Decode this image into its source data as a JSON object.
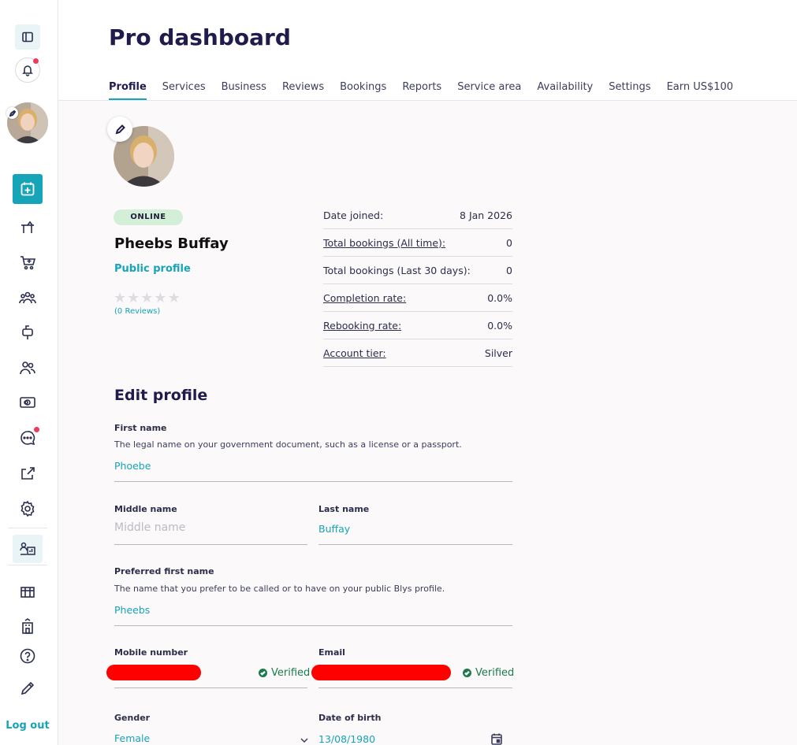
{
  "header": {
    "title": "Pro dashboard"
  },
  "tabs": [
    {
      "label": "Profile",
      "active": true
    },
    {
      "label": "Services"
    },
    {
      "label": "Business"
    },
    {
      "label": "Reviews"
    },
    {
      "label": "Bookings"
    },
    {
      "label": "Reports"
    },
    {
      "label": "Service area"
    },
    {
      "label": "Availability"
    },
    {
      "label": "Settings"
    },
    {
      "label": "Earn US$100"
    }
  ],
  "sidebar": {
    "logout_label": "Log out",
    "icons": [
      "sidebar-toggle-icon",
      "bell-icon",
      "avatar",
      "calendar-plus-icon",
      "massage-table-icon",
      "cart-icon",
      "team-icon",
      "mailbox-icon",
      "users-icon",
      "cash-icon",
      "chat-icon",
      "share-icon",
      "gear-icon",
      "pro-dashboard-icon",
      "gift-icon",
      "building-icon",
      "help-icon",
      "pencil-icon"
    ]
  },
  "profile": {
    "status": "ONLINE",
    "name": "Pheebs Buffay",
    "public_profile_label": "Public profile",
    "rating_stars": 0,
    "reviews_label": "(0 Reviews)"
  },
  "stats": [
    {
      "label": "Date joined:",
      "value": "8 Jan 2026",
      "underline": false
    },
    {
      "label": "Total bookings (All time):",
      "value": "0",
      "underline": true
    },
    {
      "label": "Total bookings (Last 30 days):",
      "value": "0",
      "underline": false
    },
    {
      "label": "Completion rate:",
      "value": "0.0%",
      "underline": true
    },
    {
      "label": "Rebooking rate:",
      "value": "0.0%",
      "underline": true
    },
    {
      "label": "Account tier:",
      "value": "Silver",
      "underline": true
    }
  ],
  "edit": {
    "title": "Edit profile",
    "first_name": {
      "label": "First name",
      "help": "The legal name on your government document, such as a license or a passport.",
      "value": "Phoebe"
    },
    "middle_name": {
      "label": "Middle name",
      "placeholder": "Middle name",
      "value": ""
    },
    "last_name": {
      "label": "Last name",
      "value": "Buffay"
    },
    "preferred_name": {
      "label": "Preferred first name",
      "help": "The name that you prefer to be called or to have on your public Blys profile.",
      "value": "Pheebs"
    },
    "mobile": {
      "label": "Mobile number",
      "verified_label": "Verified"
    },
    "email": {
      "label": "Email",
      "verified_label": "Verified"
    },
    "gender": {
      "label": "Gender",
      "value": "Female"
    },
    "dob": {
      "label": "Date of birth",
      "value": "13/08/1980"
    }
  },
  "colors": {
    "accent": "#16a4b9",
    "verified": "#1c7a4c",
    "notification_dot": "#ee3a5c",
    "online_badge": "#d4efd8"
  }
}
